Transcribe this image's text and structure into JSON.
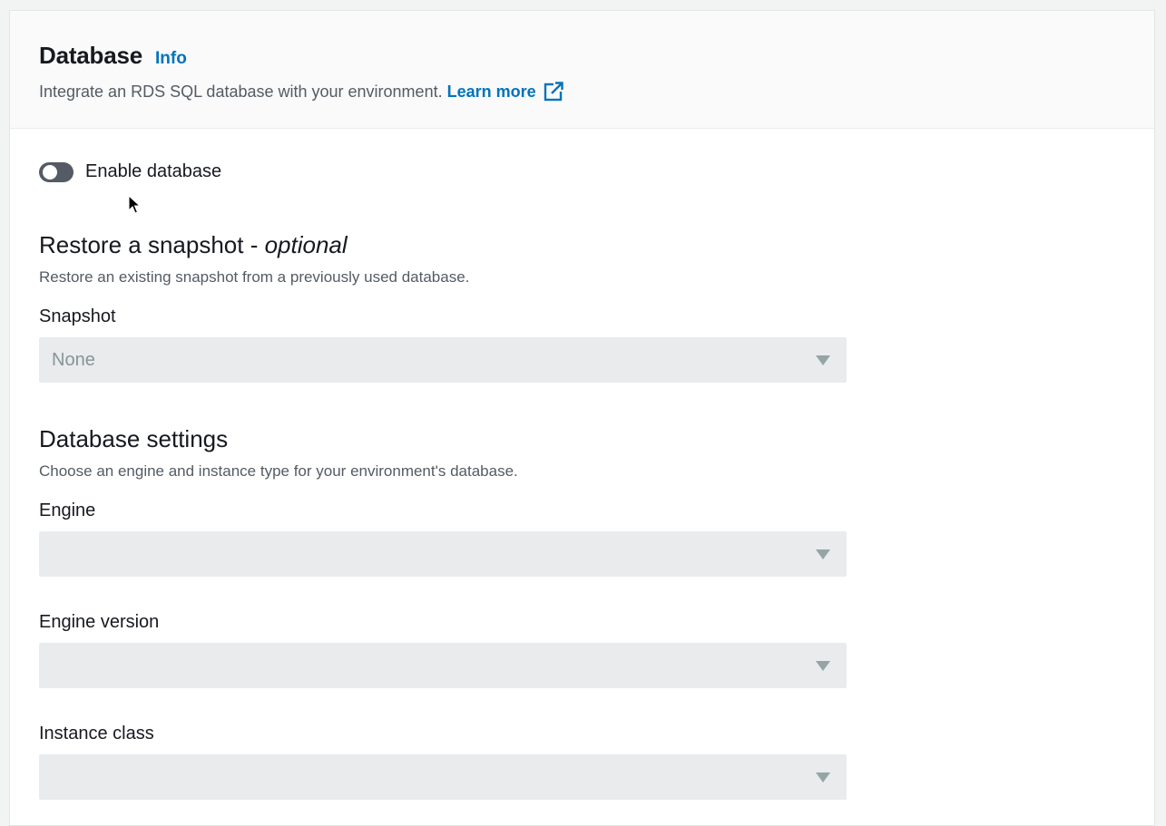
{
  "panel": {
    "title": "Database",
    "info_link": "Info",
    "description": "Integrate an RDS SQL database with your environment.",
    "learn_more": "Learn more",
    "external_icon": "external-link-icon"
  },
  "toggle": {
    "label": "Enable database",
    "enabled": false
  },
  "restore_snapshot": {
    "heading_main": "Restore a snapshot - ",
    "heading_optional": "optional",
    "description": "Restore an existing snapshot from a previously used database.",
    "snapshot_label": "Snapshot",
    "snapshot_value": "None"
  },
  "database_settings": {
    "heading": "Database settings",
    "description": "Choose an engine and instance type for your environment's database.",
    "engine_label": "Engine",
    "engine_value": "",
    "engine_version_label": "Engine version",
    "engine_version_value": "",
    "instance_class_label": "Instance class",
    "instance_class_value": ""
  },
  "colors": {
    "link": "#0073bb",
    "toggle_off": "#545b64",
    "select_disabled_bg": "#e9ebed",
    "muted_text": "#545b64"
  }
}
